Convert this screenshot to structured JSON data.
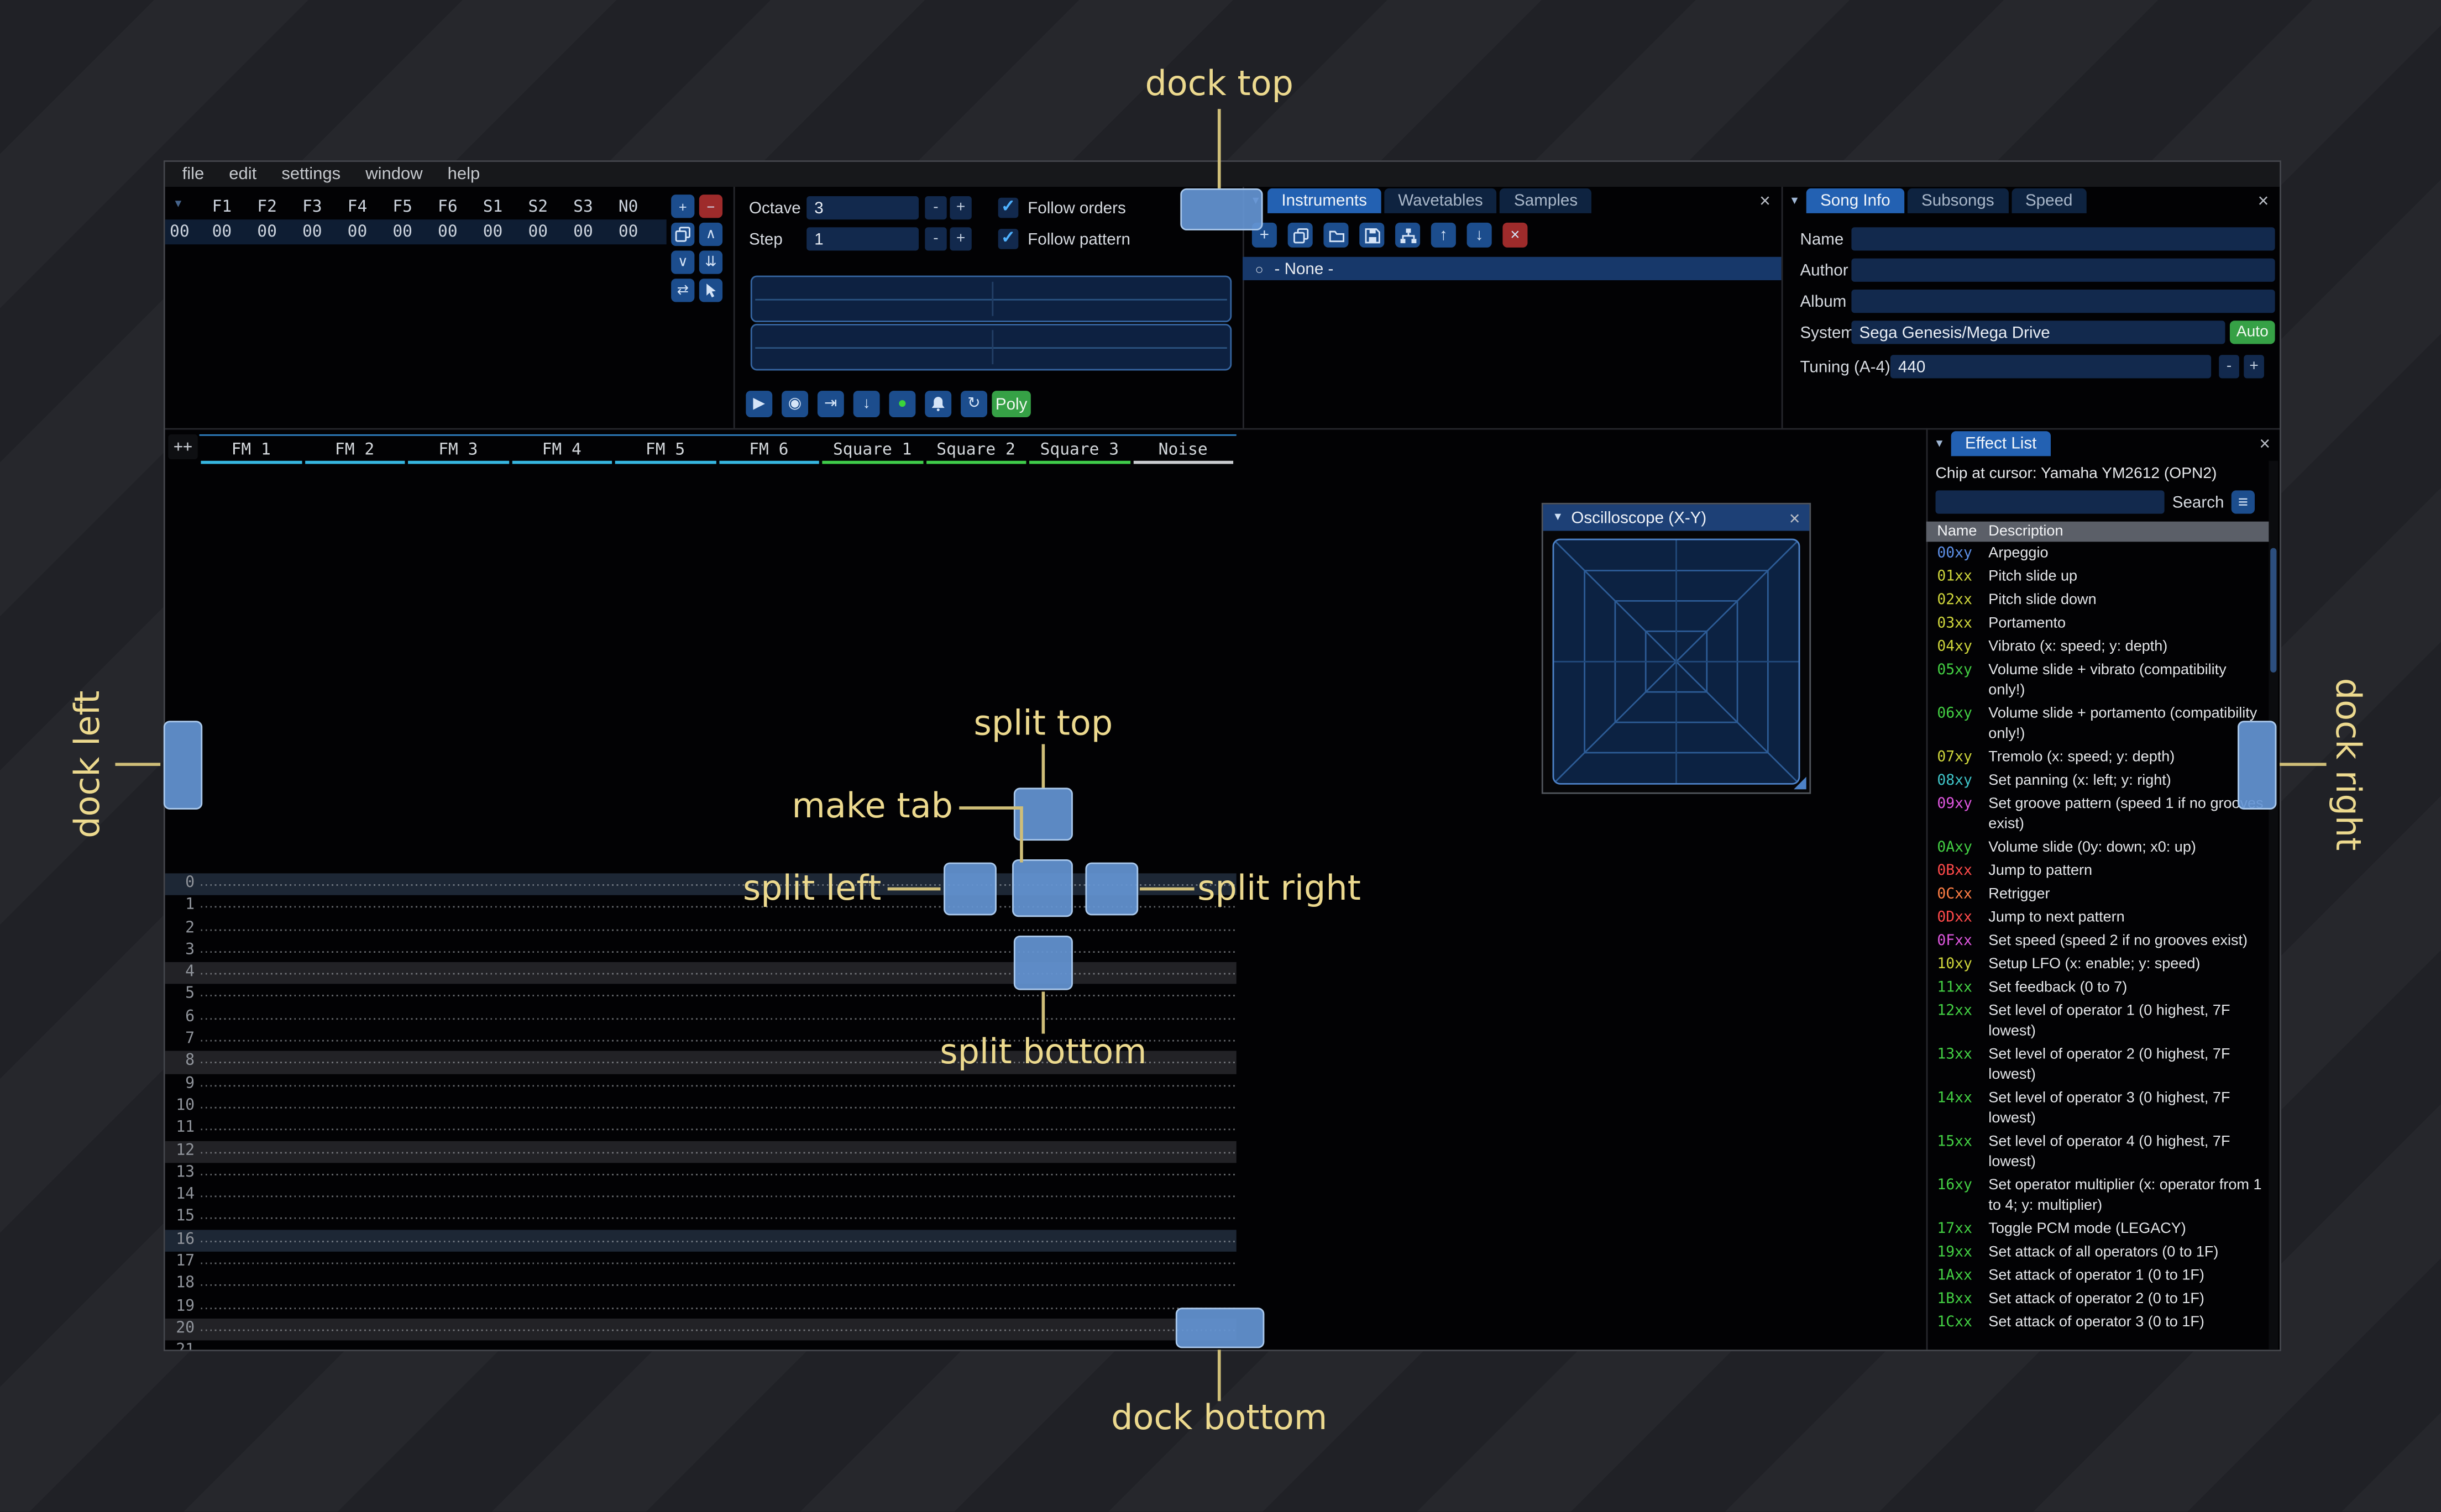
{
  "menu": {
    "items": [
      "file",
      "edit",
      "settings",
      "window",
      "help"
    ]
  },
  "icons": {
    "collapse-icon": "▼",
    "close-icon": "×",
    "check-icon": "✓",
    "add-icon": "+",
    "remove-icon": "−",
    "chevron-up-icon": "∧",
    "chevron-down-icon": "∨",
    "double-down-icon": "⇊",
    "exchange-icon": "⇄",
    "up-icon": "↑",
    "down-icon": "↓",
    "delete-icon": "×",
    "play-icon": "▶",
    "play-pattern-icon": "◉",
    "play-once-icon": "⇥",
    "step-icon": "↓",
    "record-icon": "●",
    "repeat-icon": "↻",
    "menu-icon": "≡",
    "bullet-icon": "○",
    "copy-icon": "svg",
    "folder-icon": "svg",
    "floppy-icon": "svg",
    "sitemap-icon": "svg",
    "bell-icon": "svg",
    "cursor-icon": "svg"
  },
  "colors": {
    "accent_blue": "#1c4d8d",
    "overlay_blue": "#6495d4",
    "annotation_yellow": "#ecd98e",
    "fm_channel": "#36b6e0",
    "square_channel": "#3fcc4a",
    "noise_channel": "#c9ccd0",
    "record_green": "#3bd43b",
    "button_green": "#36a146",
    "danger_red": "#9e2b2b"
  },
  "orders": {
    "channels": [
      "F1",
      "F2",
      "F3",
      "F4",
      "F5",
      "F6",
      "S1",
      "S2",
      "S3",
      "N0"
    ],
    "rows": [
      {
        "index": "00",
        "values": [
          "00",
          "00",
          "00",
          "00",
          "00",
          "00",
          "00",
          "00",
          "00",
          "00"
        ]
      }
    ],
    "buttons": [
      {
        "name": "add-order-button",
        "icon": "add-icon",
        "style": "blue"
      },
      {
        "name": "remove-order-button",
        "icon": "remove-icon",
        "style": "red"
      },
      {
        "name": "duplicate-order-button",
        "icon": "copy-icon"
      },
      {
        "name": "move-order-up-button",
        "icon": "chevron-up-icon"
      },
      {
        "name": "move-order-down-button",
        "icon": "chevron-down-icon"
      },
      {
        "name": "duplicate-order-end-button",
        "icon": "double-down-icon"
      },
      {
        "name": "order-change-mode-button",
        "icon": "exchange-icon"
      },
      {
        "name": "order-edit-mode-button",
        "icon": "cursor-icon"
      }
    ]
  },
  "playback": {
    "octave_label": "Octave",
    "octave_value": "3",
    "step_label": "Step",
    "step_value": "1",
    "minus_label": "-",
    "plus_label": "+",
    "follow_orders_label": "Follow orders",
    "follow_pattern_label": "Follow pattern",
    "poly_label": "Poly",
    "transport": [
      {
        "name": "play-button",
        "icon": "play-icon"
      },
      {
        "name": "play-pattern-button",
        "icon": "play-pattern-icon"
      },
      {
        "name": "play-once-button",
        "icon": "play-once-icon"
      },
      {
        "name": "step-row-button",
        "icon": "step-icon"
      },
      {
        "name": "edit-record-toggle",
        "icon": "record-icon",
        "icon_color": "#3bd43b"
      },
      {
        "name": "metronome-button",
        "icon": "bell-icon"
      },
      {
        "name": "repeat-pattern-button",
        "icon": "repeat-icon"
      }
    ]
  },
  "instruments": {
    "tabs": [
      "Instruments",
      "Wavetables",
      "Samples"
    ],
    "active_tab": "Instruments",
    "toolbar": [
      {
        "name": "add-instrument-button",
        "icon": "add-icon"
      },
      {
        "name": "duplicate-instrument-button",
        "icon": "copy-icon"
      },
      {
        "name": "open-instrument-button",
        "icon": "folder-icon"
      },
      {
        "name": "save-instrument-button",
        "icon": "floppy-icon"
      },
      {
        "name": "instrument-folders-button",
        "icon": "sitemap-icon"
      },
      {
        "name": "move-instrument-up-button",
        "icon": "up-icon"
      },
      {
        "name": "move-instrument-down-button",
        "icon": "down-icon"
      },
      {
        "name": "delete-instrument-button",
        "icon": "delete-icon",
        "style": "red"
      }
    ],
    "list": [
      {
        "label": "- None -",
        "selected": true
      }
    ]
  },
  "song_info": {
    "tabs": [
      "Song Info",
      "Subsongs",
      "Speed"
    ],
    "active_tab": "Song Info",
    "fields": [
      {
        "label": "Name",
        "value": ""
      },
      {
        "label": "Author",
        "value": ""
      },
      {
        "label": "Album",
        "value": ""
      }
    ],
    "system_label": "System",
    "system_value": "Sega Genesis/Mega Drive",
    "auto_label": "Auto",
    "tuning_label": "Tuning (A-4)",
    "tuning_value": "440"
  },
  "pattern": {
    "expand_label": "++",
    "visible_rows": 22,
    "channels": [
      {
        "name": "FM 1",
        "type": "fm"
      },
      {
        "name": "FM 2",
        "type": "fm"
      },
      {
        "name": "FM 3",
        "type": "fm"
      },
      {
        "name": "FM 4",
        "type": "fm"
      },
      {
        "name": "FM 5",
        "type": "fm"
      },
      {
        "name": "FM 6",
        "type": "fm"
      },
      {
        "name": "Square 1",
        "type": "square"
      },
      {
        "name": "Square 2",
        "type": "square"
      },
      {
        "name": "Square 3",
        "type": "square"
      },
      {
        "name": "Noise",
        "type": "noise"
      }
    ]
  },
  "oscilloscope_xy": {
    "title": "Oscilloscope (X-Y)"
  },
  "effect_list": {
    "tab": "Effect List",
    "chip_line": "Chip at cursor: Yamaha YM2612 (OPN2)",
    "search_label": "Search",
    "search_value": "",
    "columns": [
      "Name",
      "Description"
    ],
    "effects": [
      {
        "name": "00xy",
        "desc": "Arpeggio",
        "color": "#5d8fe6"
      },
      {
        "name": "01xx",
        "desc": "Pitch slide up",
        "color": "#ced53b"
      },
      {
        "name": "02xx",
        "desc": "Pitch slide down",
        "color": "#ced53b"
      },
      {
        "name": "03xx",
        "desc": "Portamento",
        "color": "#ced53b"
      },
      {
        "name": "04xy",
        "desc": "Vibrato (x: speed; y: depth)",
        "color": "#ced53b"
      },
      {
        "name": "05xy",
        "desc": "Volume slide + vibrato (compatibility only!)",
        "color": "#43cf43"
      },
      {
        "name": "06xy",
        "desc": "Volume slide + portamento (compatibility only!)",
        "color": "#43cf43"
      },
      {
        "name": "07xy",
        "desc": "Tremolo (x: speed; y: depth)",
        "color": "#ced53b"
      },
      {
        "name": "08xy",
        "desc": "Set panning (x: left; y: right)",
        "color": "#3fc4c8"
      },
      {
        "name": "09xy",
        "desc": "Set groove pattern (speed 1 if no grooves exist)",
        "color": "#df57df"
      },
      {
        "name": "0Axy",
        "desc": "Volume slide (0y: down; x0: up)",
        "color": "#43cf43"
      },
      {
        "name": "0Bxx",
        "desc": "Jump to pattern",
        "color": "#ff4a4a"
      },
      {
        "name": "0Cxx",
        "desc": "Retrigger",
        "color": "#ff7e45"
      },
      {
        "name": "0Dxx",
        "desc": "Jump to next pattern",
        "color": "#ff4a4a"
      },
      {
        "name": "0Fxx",
        "desc": "Set speed (speed 2 if no grooves exist)",
        "color": "#df57df"
      },
      {
        "name": "10xy",
        "desc": "Setup LFO (x: enable; y: speed)",
        "color": "#ced53b"
      },
      {
        "name": "11xx",
        "desc": "Set feedback (0 to 7)",
        "color": "#43cf43"
      },
      {
        "name": "12xx",
        "desc": "Set level of operator 1 (0 highest, 7F lowest)",
        "color": "#43cf43"
      },
      {
        "name": "13xx",
        "desc": "Set level of operator 2 (0 highest, 7F lowest)",
        "color": "#43cf43"
      },
      {
        "name": "14xx",
        "desc": "Set level of operator 3 (0 highest, 7F lowest)",
        "color": "#43cf43"
      },
      {
        "name": "15xx",
        "desc": "Set level of operator 4 (0 highest, 7F lowest)",
        "color": "#43cf43"
      },
      {
        "name": "16xy",
        "desc": "Set operator multiplier (x: operator from 1 to 4; y: multiplier)",
        "color": "#43cf43"
      },
      {
        "name": "17xx",
        "desc": "Toggle PCM mode (LEGACY)",
        "color": "#43cf43"
      },
      {
        "name": "19xx",
        "desc": "Set attack of all operators (0 to 1F)",
        "color": "#43cf43"
      },
      {
        "name": "1Axx",
        "desc": "Set attack of operator 1 (0 to 1F)",
        "color": "#43cf43"
      },
      {
        "name": "1Bxx",
        "desc": "Set attack of operator 2 (0 to 1F)",
        "color": "#43cf43"
      },
      {
        "name": "1Cxx",
        "desc": "Set attack of operator 3 (0 to 1F)",
        "color": "#43cf43"
      }
    ]
  },
  "overlays": {
    "labels": {
      "dock_top": "dock top",
      "dock_bottom": "dock bottom",
      "dock_left": "dock left",
      "dock_right": "dock right",
      "split_top": "split top",
      "split_bottom": "split bottom",
      "split_left": "split left",
      "split_right": "split right",
      "make_tab": "make tab"
    },
    "label_color": "#ecd98e",
    "line_color": "#cfbe78",
    "overlay_fill": "#6495d4"
  }
}
